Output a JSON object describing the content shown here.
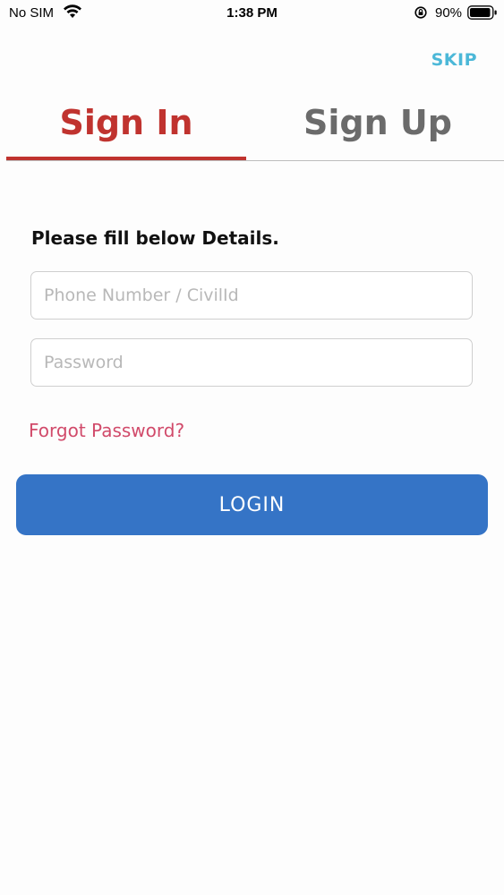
{
  "status_bar": {
    "carrier": "No SIM",
    "time": "1:38 PM",
    "battery_percent": "90%",
    "icons": [
      "wifi-icon",
      "lock-rotation-icon",
      "battery-icon"
    ]
  },
  "header": {
    "skip_label": "SKIP"
  },
  "tabs": [
    {
      "label": "Sign In",
      "active": true
    },
    {
      "label": "Sign Up",
      "active": false
    }
  ],
  "form": {
    "heading": "Please fill below Details.",
    "phone": {
      "placeholder": "Phone Number / CivilId",
      "value": ""
    },
    "password": {
      "placeholder": "Password",
      "value": ""
    },
    "forgot_label": "Forgot Password?",
    "login_label": "LOGIN"
  },
  "colors": {
    "active_tab": "#c0332f",
    "inactive_tab": "#6b6b6b",
    "skip": "#4cb8d8",
    "forgot": "#d14a6a",
    "login_button": "#3574c6"
  }
}
